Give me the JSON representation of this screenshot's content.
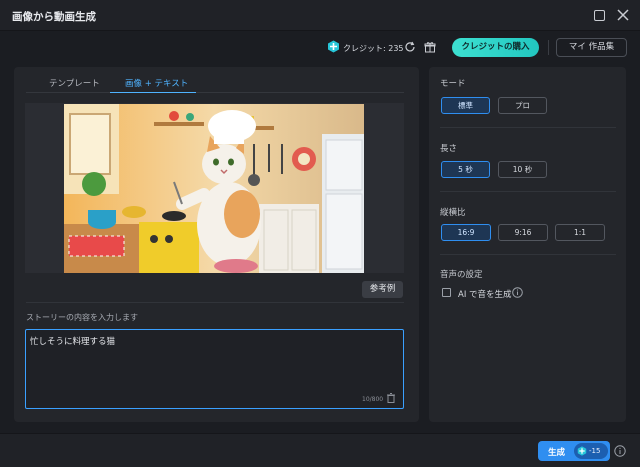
{
  "window": {
    "title": "画像から動画生成"
  },
  "topbar": {
    "credits_text": "クレジット: 235",
    "buy_label": "クレジットの購入",
    "works_label": "マイ 作品集"
  },
  "tabs": [
    {
      "label": "テンプレート",
      "active": false
    },
    {
      "label": "画像 + テキスト",
      "active": true
    }
  ],
  "preview": {
    "reference_label": "参考例"
  },
  "story": {
    "label": "ストーリーの内容を入力します",
    "value": "忙しそうに料理する猫",
    "counter": "10/800"
  },
  "settings": {
    "mode": {
      "label": "モード",
      "options": [
        "標準",
        "プロ"
      ],
      "selected": "標準"
    },
    "length": {
      "label": "長さ",
      "options": [
        "5 秒",
        "10 秒"
      ],
      "selected": "5 秒"
    },
    "aspect": {
      "label": "縦横比",
      "options": [
        "16:9",
        "9:16",
        "1:1"
      ],
      "selected": "16:9"
    },
    "audio": {
      "label": "音声の設定",
      "checkbox_label": "AI で音を生成",
      "checked": false
    }
  },
  "footer": {
    "generate_label": "生成",
    "cost": "-15"
  },
  "colors": {
    "accent_blue": "#2f8ef0",
    "buy_teal": "#3de0d1",
    "background": "#1b1d22"
  }
}
